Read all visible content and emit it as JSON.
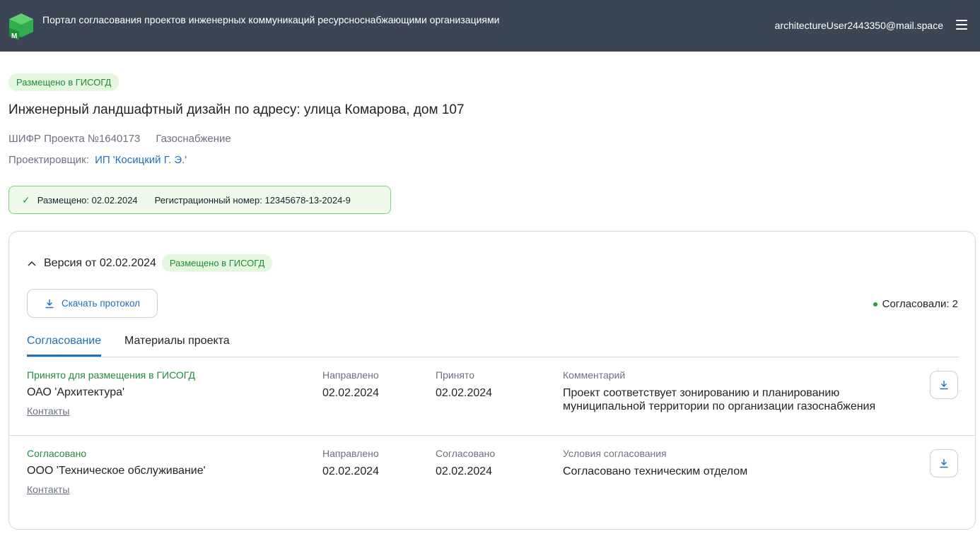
{
  "header": {
    "portal_title": "Портал согласования проектов инженерных коммуникаций ресурсноснабжающими организациями",
    "user_email": "architectureUser2443350@mail.space",
    "logo_letter": "М",
    "menu_icon": "hamburger-menu-icon",
    "bg_color": "#3b4554",
    "logo_color": "#2fae4f"
  },
  "project": {
    "status_badge": "Размещено в ГИСОГД",
    "title": "Инженерный ландшафтный дизайн по адресу: улица Комарова, дом 107",
    "code": "ШИФР Проекта №1640173",
    "category": "Газоснабжение",
    "designer_label": "Проектировщик:",
    "designer_name": "ИП 'Косицкий Г. Э.'"
  },
  "placement": {
    "check_icon": "check-icon",
    "placed_text": "Размещено: 02.02.2024",
    "reg_text": "Регистрационный номер: 12345678-13-2024-9"
  },
  "version": {
    "label": "Версия от 02.02.2024",
    "badge": "Размещено в ГИСОГД",
    "download_label": "Скачать протокол",
    "approved_count": "Согласовали: 2"
  },
  "tabs": [
    {
      "label": "Согласование",
      "active": true
    },
    {
      "label": "Материалы проекта",
      "active": false
    }
  ],
  "approvals": [
    {
      "status": "Принято для размещения в ГИСОГД",
      "org": "ОАО 'Архитектура'",
      "contacts": "Контакты",
      "col1_label": "Направлено",
      "col1_value": "02.02.2024",
      "col2_label": "Принято",
      "col2_value": "02.02.2024",
      "col3_label": "Комментарий",
      "col3_value": "Проект соответствует зонированию и планированию муниципальной территории по организации газоснабжения"
    },
    {
      "status": "Согласовано",
      "org": "ООО 'Техническое обслуживание'",
      "contacts": "Контакты",
      "col1_label": "Направлено",
      "col1_value": "02.02.2024",
      "col2_label": "Согласовано",
      "col2_value": "02.02.2024",
      "col3_label": "Условия согласования",
      "col3_value": "Согласовано техническим отделом"
    }
  ]
}
